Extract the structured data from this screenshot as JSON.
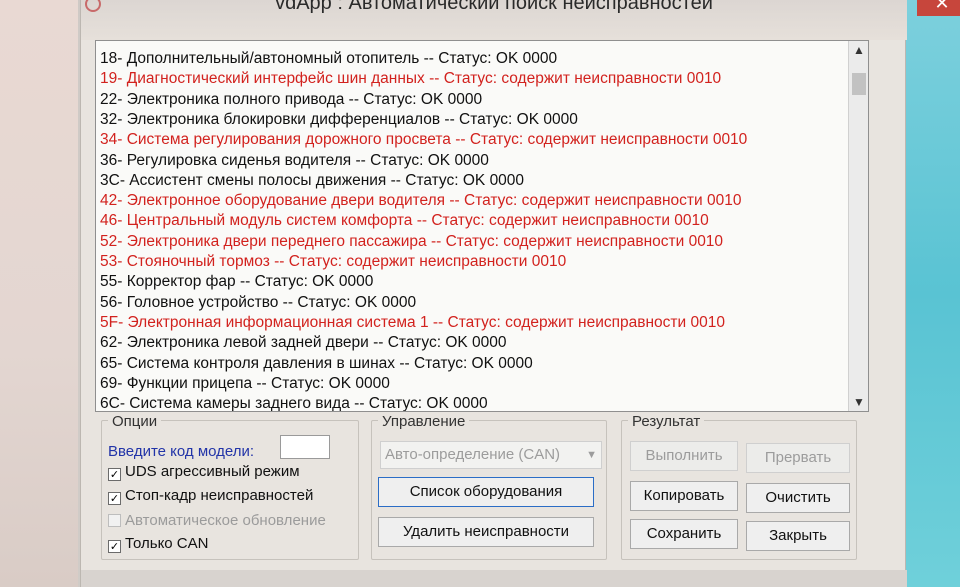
{
  "window": {
    "title": "vdApp :  Автоматический поиск неисправностей"
  },
  "results_list": [
    {
      "text": "18- Дополнительный/автономный отопитель -- Статус: OK 0000",
      "status": "ok"
    },
    {
      "text": "19- Диагностический интерфейс шин данных -- Статус: содержит неисправности 0010",
      "status": "err"
    },
    {
      "text": "22- Электроника полного привода -- Статус: OK 0000",
      "status": "ok"
    },
    {
      "text": "32- Электроника блокировки дифференциалов -- Статус: OK 0000",
      "status": "ok"
    },
    {
      "text": "34- Система регулирования дорожного просвета -- Статус: содержит неисправности 0010",
      "status": "err"
    },
    {
      "text": "36- Регулировка сиденья водителя -- Статус: OK 0000",
      "status": "ok"
    },
    {
      "text": "3C- Ассистент смены полосы движения -- Статус: OK 0000",
      "status": "ok"
    },
    {
      "text": "42- Электронное оборудование двери водителя -- Статус: содержит неисправности 0010",
      "status": "err"
    },
    {
      "text": "46- Центральный модуль систем комфорта -- Статус: содержит неисправности 0010",
      "status": "err"
    },
    {
      "text": "52- Электроника двери переднего пассажира -- Статус: содержит неисправности 0010",
      "status": "err"
    },
    {
      "text": "53- Стояночный тормоз -- Статус: содержит неисправности 0010",
      "status": "err"
    },
    {
      "text": "55- Корректор фар -- Статус: OK 0000",
      "status": "ok"
    },
    {
      "text": "56- Головное устройство -- Статус: OK 0000",
      "status": "ok"
    },
    {
      "text": "5F- Электронная информационная система 1 -- Статус: содержит неисправности 0010",
      "status": "err"
    },
    {
      "text": "62- Электроника левой задней двери -- Статус: OK 0000",
      "status": "ok"
    },
    {
      "text": "65- Система контроля давления в шинах -- Статус: OK 0000",
      "status": "ok"
    },
    {
      "text": "69- Функции прицепа -- Статус: OK 0000",
      "status": "ok"
    },
    {
      "text": "6C- Система камеры заднего вида -- Статус: OK 0000",
      "status": "ok"
    }
  ],
  "options": {
    "title": "Опции",
    "model_code_label": "Введите код модели:",
    "model_code_value": "",
    "checkboxes": [
      {
        "label": "UDS агрессивный режим",
        "checked": true,
        "enabled": true
      },
      {
        "label": "Стоп-кадр неисправностей",
        "checked": true,
        "enabled": true
      },
      {
        "label": "Автоматическое обновление",
        "checked": false,
        "enabled": false
      },
      {
        "label": "Только CAN",
        "checked": true,
        "enabled": true
      }
    ]
  },
  "control": {
    "title": "Управление",
    "mode_select": "Авто-определение (CAN)",
    "equipment_list_button": "Список оборудования",
    "clear_faults_button": "Удалить неисправности"
  },
  "result": {
    "title": "Результат",
    "execute_button": "Выполнить",
    "abort_button": "Прервать",
    "copy_button": "Копировать",
    "clear_button": "Очистить",
    "save_button": "Сохранить",
    "close_button": "Закрыть"
  },
  "colors": {
    "error_text": "#d2221e",
    "ok_text": "#111111",
    "focus_border": "#2b6dc6"
  },
  "icons": {
    "scroll_up": "▲",
    "scroll_down": "▼",
    "close": "✕",
    "check": "✓"
  }
}
